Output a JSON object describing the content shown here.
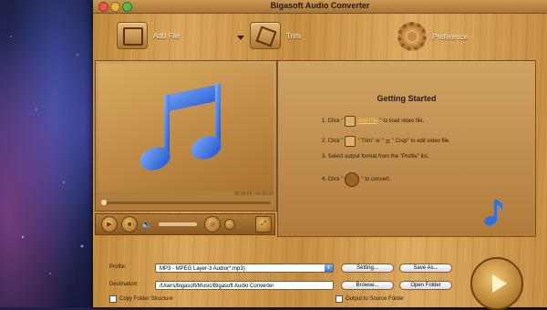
{
  "window": {
    "title": "Bigasoft Audio Converter"
  },
  "toolbar": {
    "add_file": "Add File",
    "trim": "Trim",
    "preference": "Preference"
  },
  "player": {
    "time": "00:00:00 / 00:00:00"
  },
  "getting_started": {
    "title": "Getting Started",
    "step1_pre": "1. Click \"",
    "step1_link": "Add File",
    "step1_post": "\" to load video file.",
    "step2_pre": "2. Click \"",
    "step2_mid1": "\" Trim\" or \"",
    "step2_post": "\" Crop\" to edit video file.",
    "step3": "3. Select output format from the \"Profile\" list.",
    "step4_pre": "4. Click \"",
    "step4_post": "\" to convert."
  },
  "bottom": {
    "profile_label": "Profile:",
    "profile_value": "MP3 - MPEG Layer-3 Audio(*.mp3)",
    "settings": "Setting...",
    "save_as": "Save As...",
    "destination_label": "Destination:",
    "destination_value": "/Users/bigasoft/Music/Bigasoft Audio Converter",
    "browse": "Browse...",
    "open_folder": "Open Folder",
    "copy_folder": "Copy Folder Structure",
    "output_source": "Output to Source Folder"
  },
  "colors": {
    "accent_link": "#f7d23a",
    "music_note": "#2f6fe0"
  }
}
